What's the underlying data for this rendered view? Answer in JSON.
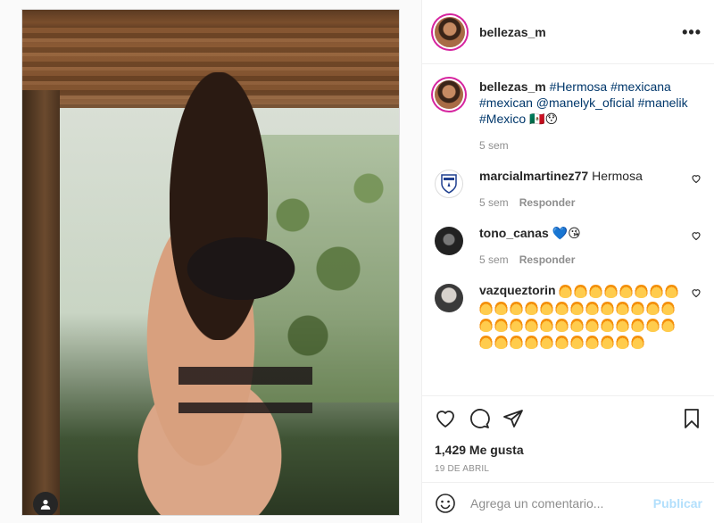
{
  "post": {
    "username": "bellezas_m",
    "caption": {
      "user": "bellezas_m",
      "segments": [
        {
          "type": "tag",
          "text": "#Hermosa"
        },
        {
          "type": "tag",
          "text": "#mexicana"
        },
        {
          "type": "tag",
          "text": "#mexican"
        },
        {
          "type": "tag",
          "text": "@manelyk_oficial"
        },
        {
          "type": "tag",
          "text": "#manelik"
        },
        {
          "type": "tag",
          "text": "#Mexico"
        },
        {
          "type": "text",
          "text": "🇲🇽😯"
        }
      ],
      "time": "5 sem"
    },
    "likes": "1,429 Me gusta",
    "date": "19 DE ABRIL"
  },
  "comments": [
    {
      "user": "marcialmartinez77",
      "text": "Hermosa",
      "time": "5 sem",
      "reply": "Responder"
    },
    {
      "user": "tono_canas",
      "text": "💙😘",
      "time": "5 sem",
      "reply": "Responder"
    },
    {
      "user": "vazqueztorin",
      "flame_count": 45,
      "time": "",
      "reply": ""
    }
  ],
  "comment_box": {
    "placeholder": "Agrega un comentario...",
    "publish_label": "Publicar"
  },
  "icons": {
    "more": "more-options-icon",
    "like": "heart-icon",
    "comment": "comment-icon",
    "share": "send-icon",
    "save": "bookmark-icon",
    "emoji": "emoji-icon",
    "user_tag": "user-tag-icon"
  },
  "colors": {
    "tag": "#00376b",
    "muted": "#8e8e8e",
    "publish_disabled": "#b2dffc",
    "story_ring": "#d6249f"
  }
}
